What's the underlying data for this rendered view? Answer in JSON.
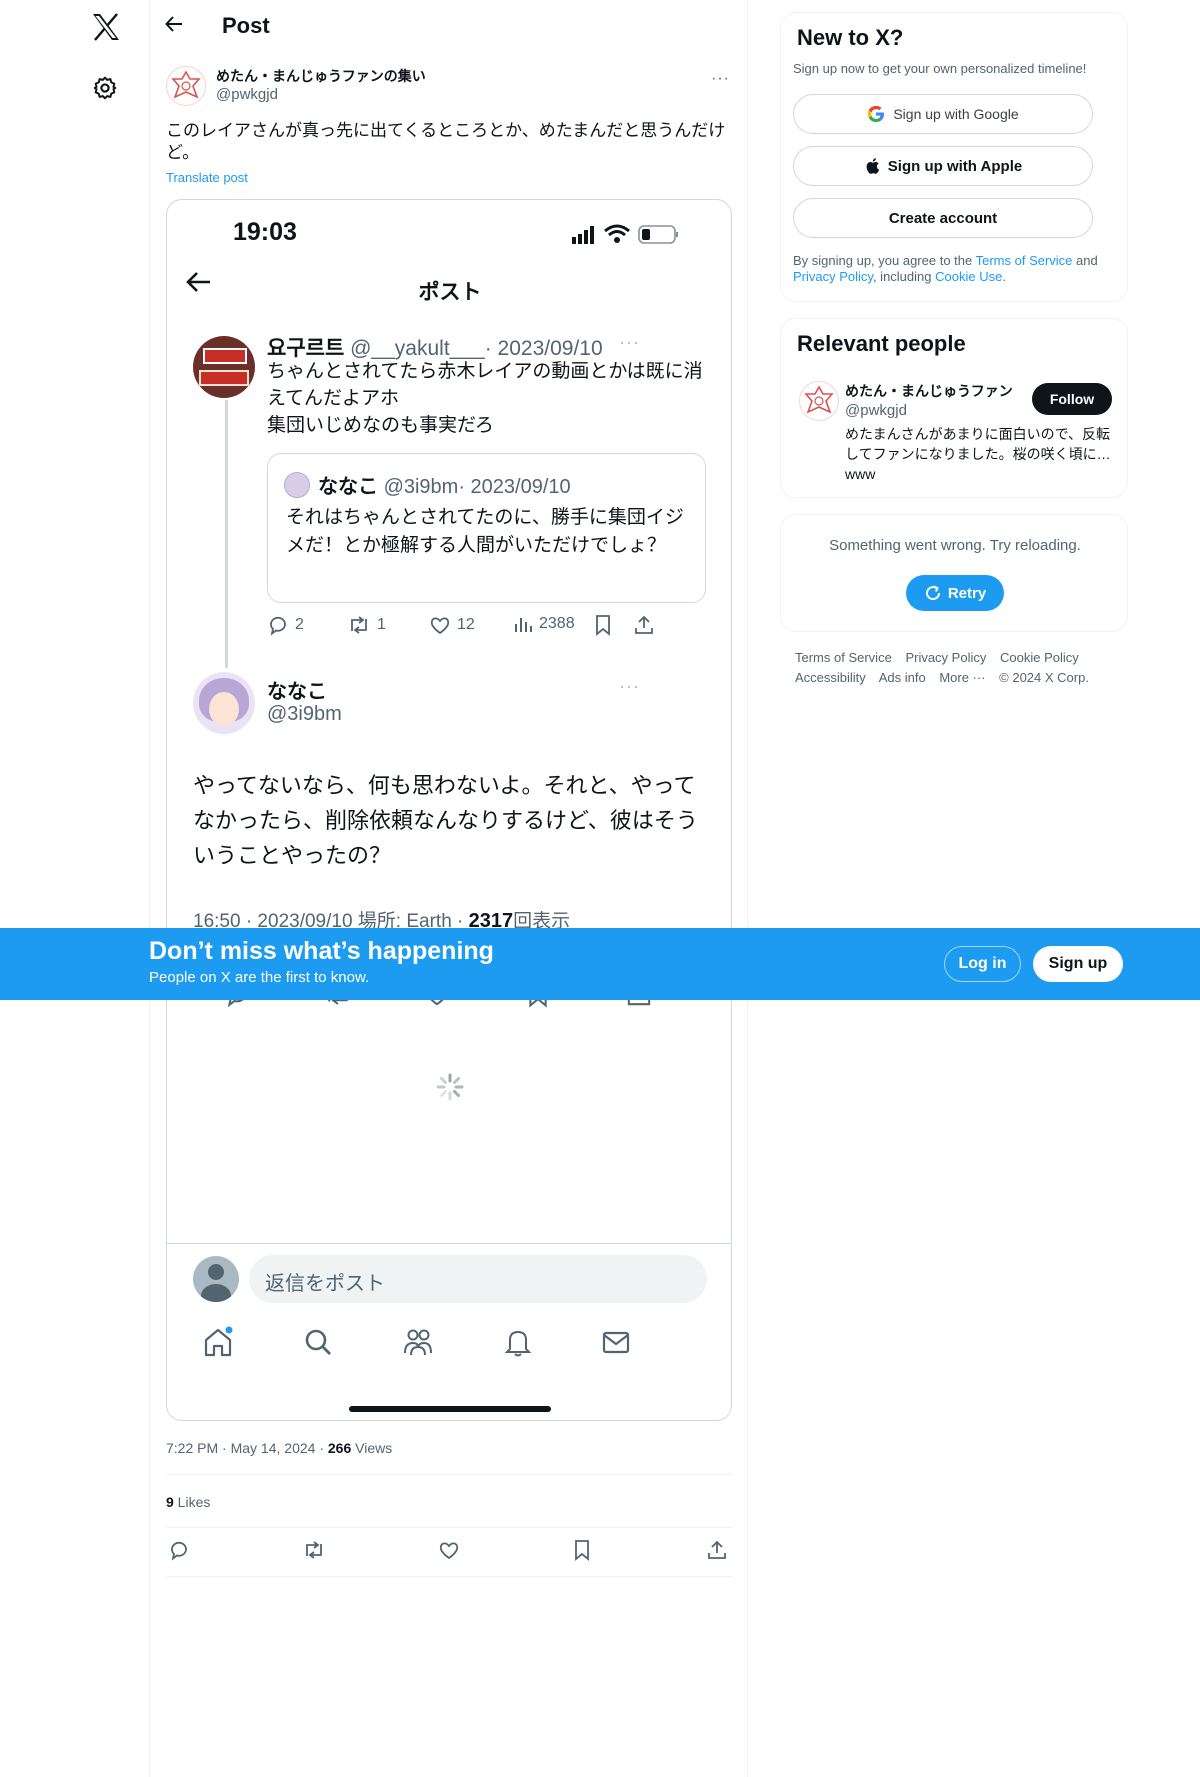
{
  "header": {
    "title": "Post"
  },
  "post": {
    "author_name": "めたん・まんじゅうファンの集い",
    "author_handle": "@pwkgjd",
    "more": "···",
    "text": "このレイアさんが真っ先に出てくるところとか、めたまんだと思うんだけど。",
    "translate": "Translate post",
    "time": "7:22 PM",
    "date": "May 14, 2024",
    "views_count": "266",
    "views_label": " Views",
    "likes_count": "9",
    "likes_label": " Likes"
  },
  "screenshot": {
    "clock": "19:03",
    "title": "ポスト",
    "tweet1": {
      "name": "요구르트",
      "handle": "@__yakult___",
      "date": "· 2023/09/10",
      "more": "···",
      "text": "ちゃんとされてたら赤木レイアの動画とかは既に消えてんだよアホ\n集団いじめなのも事実だろ",
      "quote": {
        "name": "ななこ",
        "handle": "@3i9bm",
        "date": "· 2023/09/10",
        "text": "それはちゃんとされてたのに、勝手に集団イジメだ！とか極解する人間がいただけでしょ？"
      },
      "replies": "2",
      "reposts": "1",
      "likes": "12",
      "views": "2388"
    },
    "tweet2": {
      "name": "ななこ",
      "handle": "@3i9bm",
      "more": "···",
      "text": "やってないなら、何も思わないよ。それと、やってなかったら、削除依頼なんなりするけど、彼はそういうことやったの？",
      "meta_prefix": "16:50 · 2023/09/10 場所: Earth · ",
      "meta_views": "2317",
      "meta_suffix": "回表示"
    },
    "reply_placeholder": "返信をポスト"
  },
  "signup_card": {
    "title": "New to X?",
    "subtitle": "Sign up now to get your own personalized timeline!",
    "google": "Sign up with Google",
    "apple": "Sign up with Apple",
    "create": "Create account",
    "legal_1": "By signing up, you agree to the ",
    "tos": "Terms of Service",
    "legal_2": " and ",
    "privacy": "Privacy Policy",
    "legal_3": ", including ",
    "cookie": "Cookie Use",
    "legal_4": "."
  },
  "relevant": {
    "title": "Relevant people",
    "name": "めたん・まんじゅうファン",
    "handle": "@pwkgjd",
    "follow": "Follow",
    "bio": "めたまんさんがあまりに面白いので、反転してファンになりました。桜の咲く頃に…www"
  },
  "error_card": {
    "message": "Something went wrong. Try reloading.",
    "retry": "Retry"
  },
  "footer": {
    "links": [
      "Terms of Service",
      "Privacy Policy",
      "Cookie Policy",
      "Accessibility",
      "Ads info",
      "More ···",
      "© 2024 X Corp."
    ]
  },
  "banner": {
    "title": "Don’t miss what’s happening",
    "subtitle": "People on X are the first to know.",
    "login": "Log in",
    "signup": "Sign up"
  },
  "colors": {
    "accent": "#1d9bf0",
    "text": "#0f1419",
    "muted": "#536471",
    "border": "#eff3f4"
  }
}
